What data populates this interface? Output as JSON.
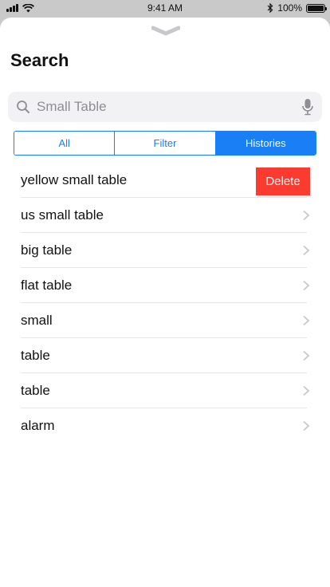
{
  "status_bar": {
    "time": "9:41 AM",
    "battery_text": "100%",
    "battery_level": 1.0,
    "icons": [
      "signal-icon",
      "wifi-icon",
      "bluetooth-icon",
      "battery-icon"
    ]
  },
  "sheet": {
    "title": "Search",
    "grabber_icon": "chevron-down-icon"
  },
  "search": {
    "placeholder": "Small Table",
    "icons": [
      "search-icon",
      "microphone-icon"
    ]
  },
  "segments": [
    {
      "label": "All",
      "active": false
    },
    {
      "label": "Filter",
      "active": false
    },
    {
      "label": "Histories",
      "active": true
    }
  ],
  "histories": [
    {
      "label": "yellow small table",
      "action": "Delete"
    },
    {
      "label": "us small table"
    },
    {
      "label": "big table"
    },
    {
      "label": "flat table"
    },
    {
      "label": "small"
    },
    {
      "label": "table"
    },
    {
      "label": "table"
    },
    {
      "label": "alarm"
    }
  ],
  "colors": {
    "accent": "#1a7ff5",
    "delete": "#fb3b30",
    "separator": "#e5e5ea",
    "search_bg": "#f2f2f4"
  }
}
